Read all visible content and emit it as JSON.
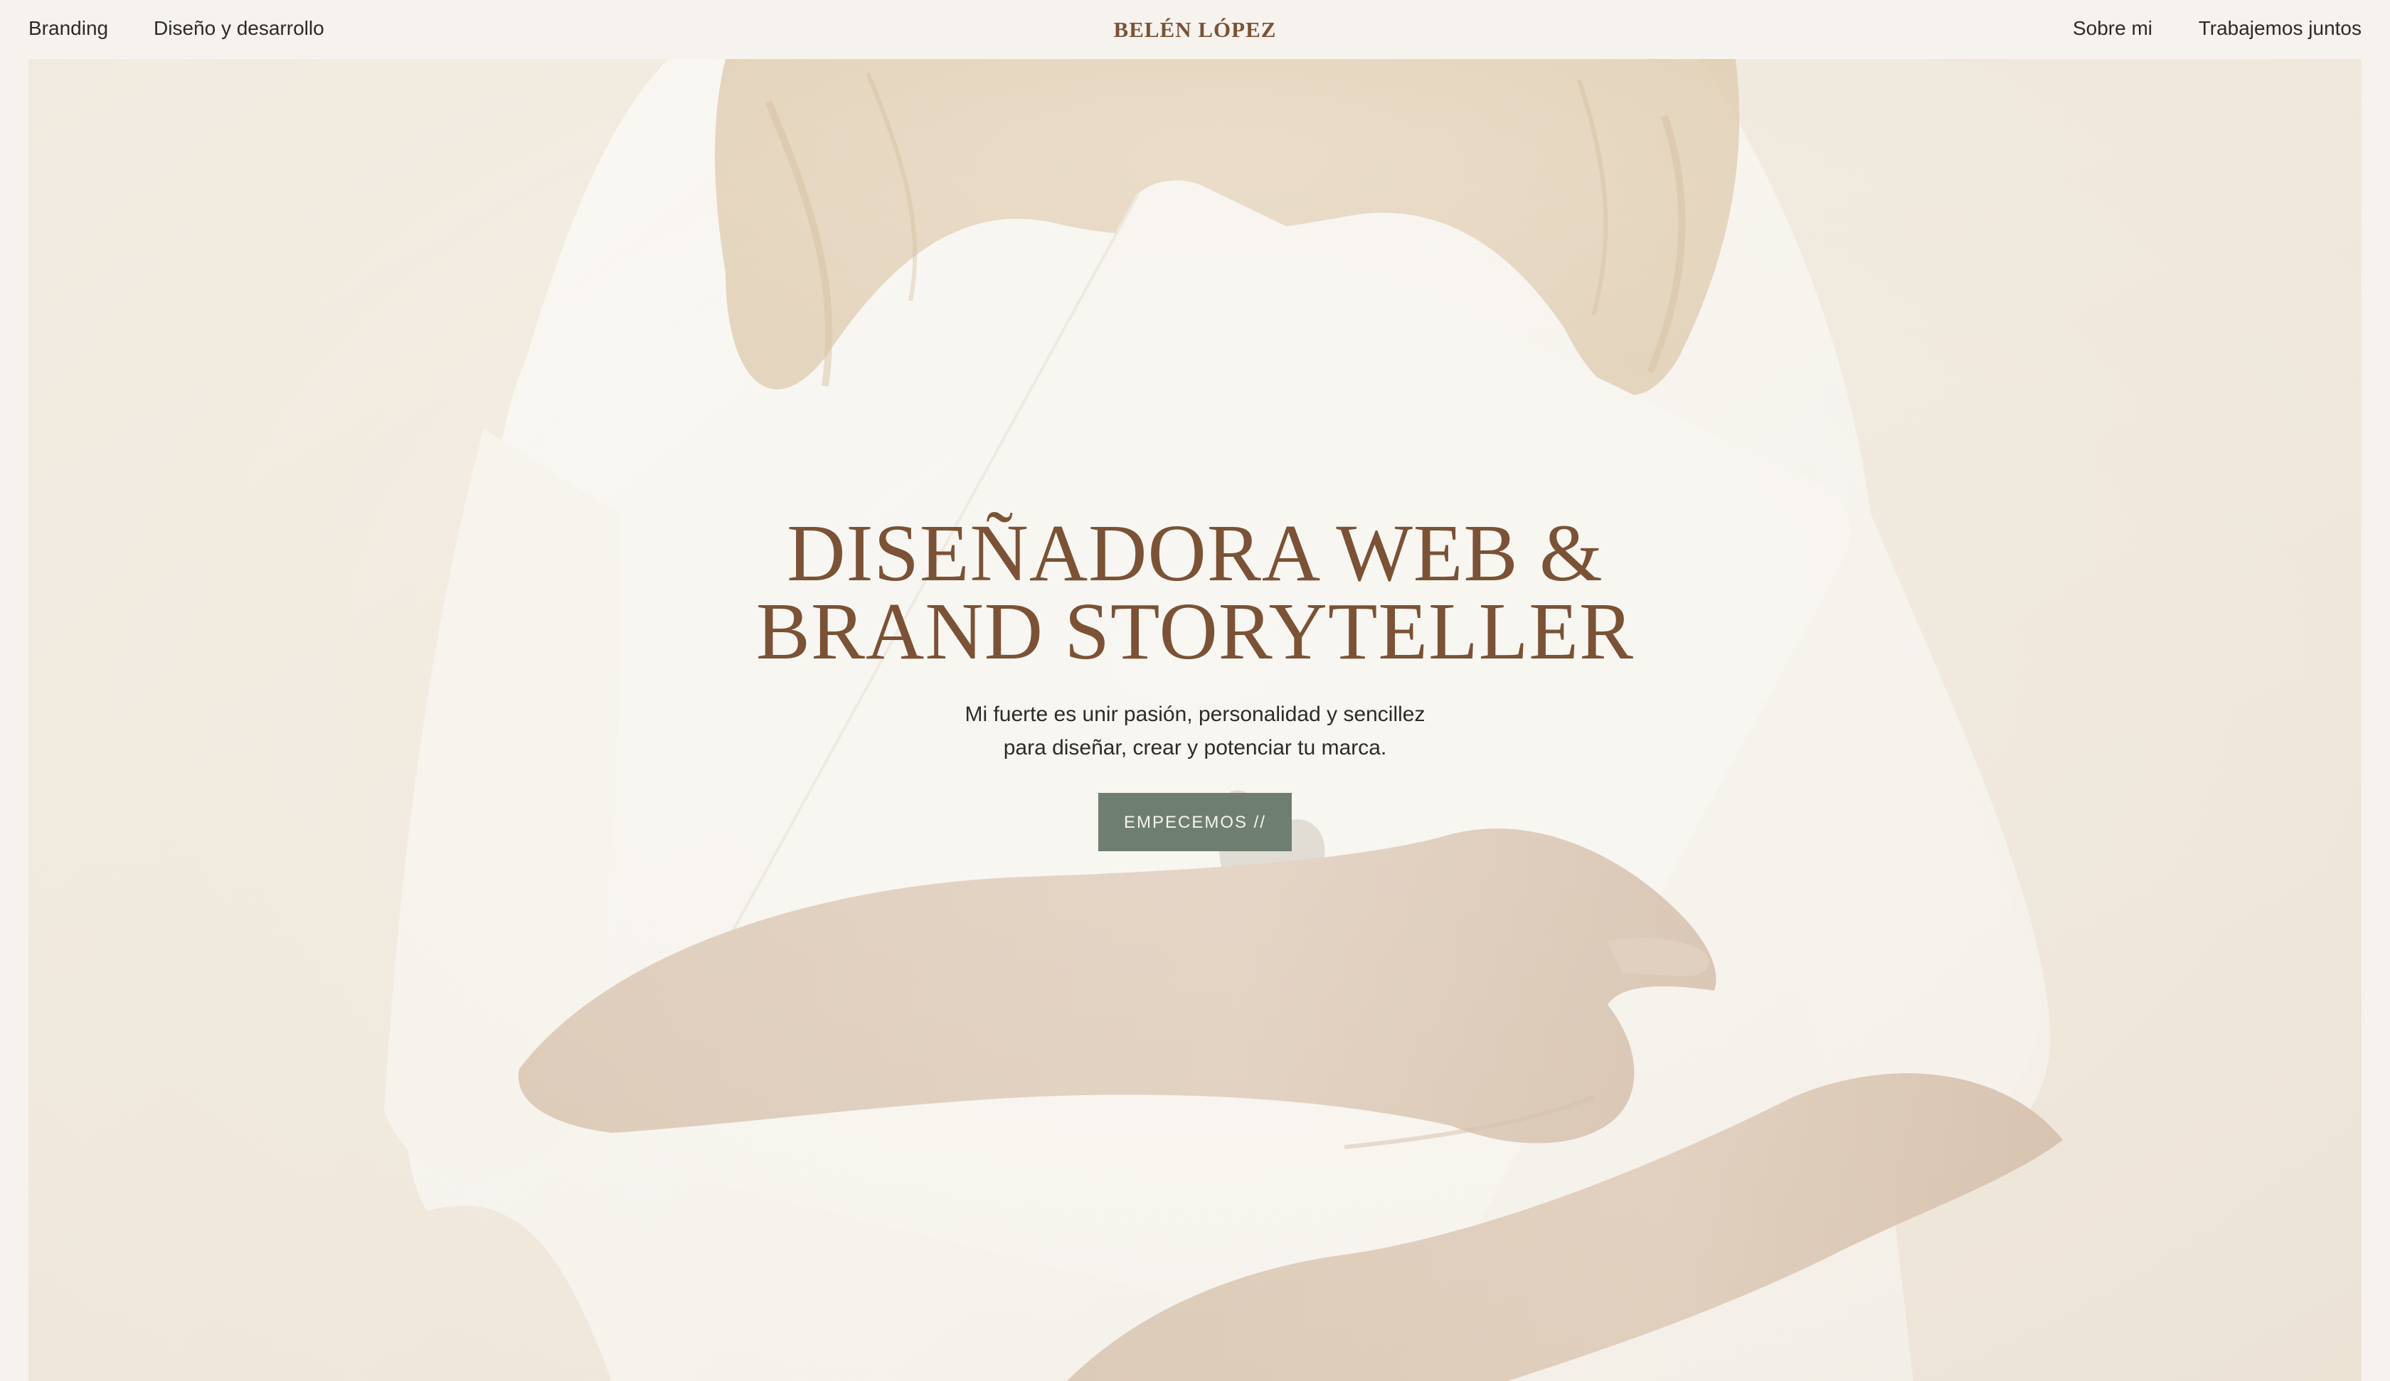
{
  "header": {
    "nav_left": [
      {
        "label": "Branding"
      },
      {
        "label": "Diseño y desarrollo"
      }
    ],
    "logo": "BELÉN LÓPEZ",
    "nav_right": [
      {
        "label": "Sobre mi"
      },
      {
        "label": "Trabajemos juntos"
      }
    ]
  },
  "hero": {
    "title_line1": "DISEÑADORA WEB &",
    "title_line2": "BRAND STORYTELLER",
    "subtitle_line1": "Mi fuerte es unir pasión, personalidad y sencillez",
    "subtitle_line2": "para diseñar, crear y potenciar tu marca.",
    "cta_label": "EMPECEMOS //"
  },
  "colors": {
    "background": "#f6f3ee",
    "accent_brown": "#7b5236",
    "button_green": "#6e7f72",
    "text_dark": "#2d2a27"
  }
}
